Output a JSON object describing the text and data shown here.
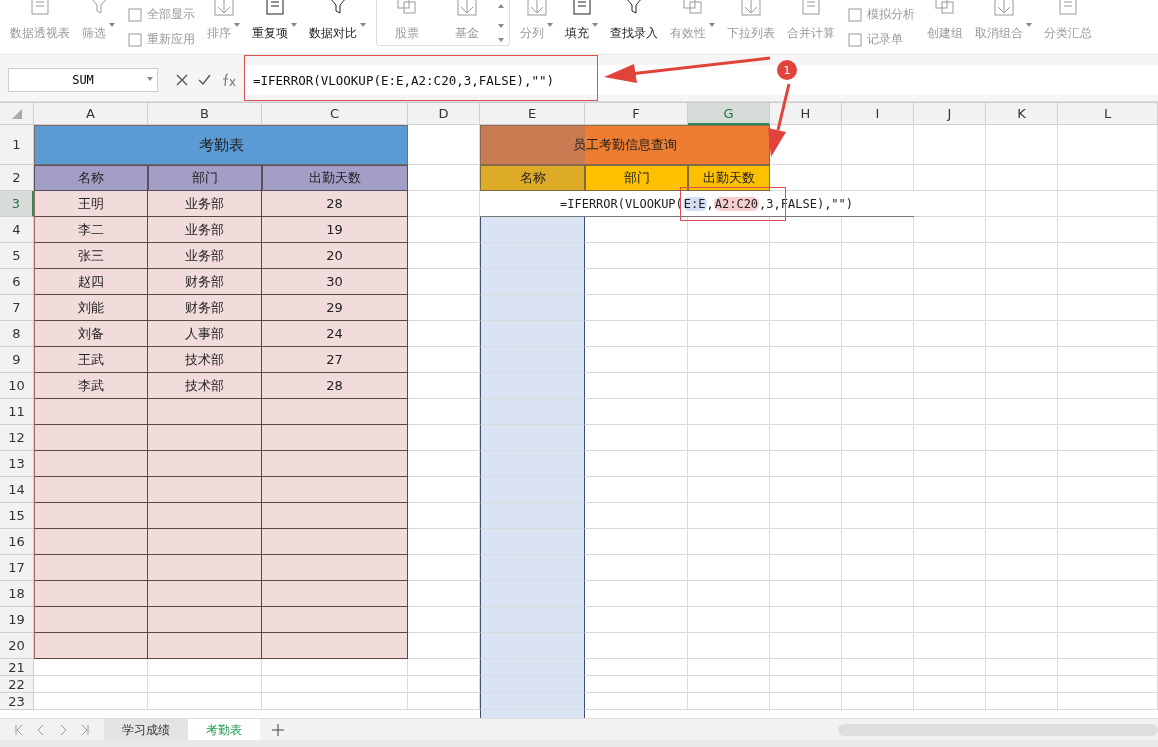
{
  "toolbar": {
    "items": [
      {
        "kind": "large",
        "label": "数据透视表",
        "dropdown": false,
        "disabled": true
      },
      {
        "kind": "large",
        "label": "筛选",
        "dropdown": true,
        "disabled": true
      },
      {
        "kind": "stacked",
        "items": [
          {
            "label": "全部显示",
            "disabled": true
          },
          {
            "label": "重新应用",
            "disabled": true
          }
        ]
      },
      {
        "kind": "large",
        "label": "排序",
        "dropdown": true,
        "disabled": true
      },
      {
        "kind": "large",
        "label": "重复项",
        "dropdown": true,
        "disabled": false
      },
      {
        "kind": "large",
        "label": "数据对比",
        "dropdown": true,
        "disabled": false
      },
      {
        "kind": "gallery",
        "items": [
          {
            "label": "股票",
            "disabled": true
          },
          {
            "label": "基金",
            "disabled": true
          }
        ]
      },
      {
        "kind": "large",
        "label": "分列",
        "dropdown": true,
        "disabled": true
      },
      {
        "kind": "large",
        "label": "填充",
        "dropdown": true,
        "disabled": false
      },
      {
        "kind": "large",
        "label": "查找录入",
        "dropdown": false,
        "disabled": false
      },
      {
        "kind": "large",
        "label": "有效性",
        "dropdown": true,
        "disabled": true
      },
      {
        "kind": "large",
        "label": "下拉列表",
        "dropdown": false,
        "disabled": true
      },
      {
        "kind": "large",
        "label": "合并计算",
        "dropdown": false,
        "disabled": true
      },
      {
        "kind": "stacked",
        "items": [
          {
            "label": "模拟分析",
            "disabled": true
          },
          {
            "label": "记录单",
            "disabled": true
          }
        ]
      },
      {
        "kind": "large",
        "label": "创建组",
        "dropdown": false,
        "disabled": true
      },
      {
        "kind": "large",
        "label": "取消组合",
        "dropdown": true,
        "disabled": true
      },
      {
        "kind": "large",
        "label": "分类汇总",
        "dropdown": false,
        "disabled": true
      }
    ]
  },
  "formula_bar": {
    "name_box": "SUM",
    "formula": "=IFERROR(VLOOKUP(E:E,A2:C20,3,FALSE),\"\")"
  },
  "columns": [
    {
      "label": "A",
      "selected": false
    },
    {
      "label": "B",
      "selected": false
    },
    {
      "label": "C",
      "selected": false
    },
    {
      "label": "D",
      "selected": false
    },
    {
      "label": "E",
      "selected": false
    },
    {
      "label": "F",
      "selected": false
    },
    {
      "label": "G",
      "selected": true
    },
    {
      "label": "H",
      "selected": false
    },
    {
      "label": "I",
      "selected": false
    },
    {
      "label": "J",
      "selected": false
    },
    {
      "label": "K",
      "selected": false
    },
    {
      "label": "L",
      "selected": false
    }
  ],
  "rows": [
    {
      "label": "1",
      "selected": false
    },
    {
      "label": "2",
      "selected": false
    },
    {
      "label": "3",
      "selected": true
    },
    {
      "label": "4",
      "selected": false
    },
    {
      "label": "5",
      "selected": false
    },
    {
      "label": "6",
      "selected": false
    },
    {
      "label": "7",
      "selected": false
    },
    {
      "label": "8",
      "selected": false
    },
    {
      "label": "9",
      "selected": false
    },
    {
      "label": "10",
      "selected": false
    },
    {
      "label": "11",
      "selected": false
    },
    {
      "label": "12",
      "selected": false
    },
    {
      "label": "13",
      "selected": false
    },
    {
      "label": "14",
      "selected": false
    },
    {
      "label": "15",
      "selected": false
    },
    {
      "label": "16",
      "selected": false
    },
    {
      "label": "17",
      "selected": false
    },
    {
      "label": "18",
      "selected": false
    },
    {
      "label": "19",
      "selected": false
    },
    {
      "label": "20",
      "selected": false
    },
    {
      "label": "21",
      "selected": false
    },
    {
      "label": "22",
      "selected": false
    },
    {
      "label": "23",
      "selected": false
    }
  ],
  "attendance_table": {
    "title": "考勤表",
    "headers": [
      "名称",
      "部门",
      "出勤天数"
    ],
    "rows": [
      [
        "王明",
        "业务部",
        "28"
      ],
      [
        "李二",
        "业务部",
        "19"
      ],
      [
        "张三",
        "业务部",
        "20"
      ],
      [
        "赵四",
        "财务部",
        "30"
      ],
      [
        "刘能",
        "财务部",
        "29"
      ],
      [
        "刘备",
        "人事部",
        "24"
      ],
      [
        "王武",
        "技术部",
        "27"
      ],
      [
        "李武",
        "技术部",
        "28"
      ]
    ]
  },
  "query_table": {
    "title": "员工考勤信息查询",
    "headers": [
      "名称",
      "部门",
      "出勤天数"
    ],
    "formula_parts": [
      {
        "text": "=IFERROR(VLOOKUP("
      },
      {
        "text": "E:E",
        "color": "#d6def5"
      },
      {
        "text": ","
      },
      {
        "text": "A2:C20",
        "color": "#f5cfcf"
      },
      {
        "text": ",3,FALSE),\"\")"
      }
    ]
  },
  "annotation": {
    "badge": "1"
  },
  "sheet_tabs": [
    {
      "label": "学习成绩",
      "selected": false
    },
    {
      "label": "考勤表",
      "selected": true
    }
  ]
}
